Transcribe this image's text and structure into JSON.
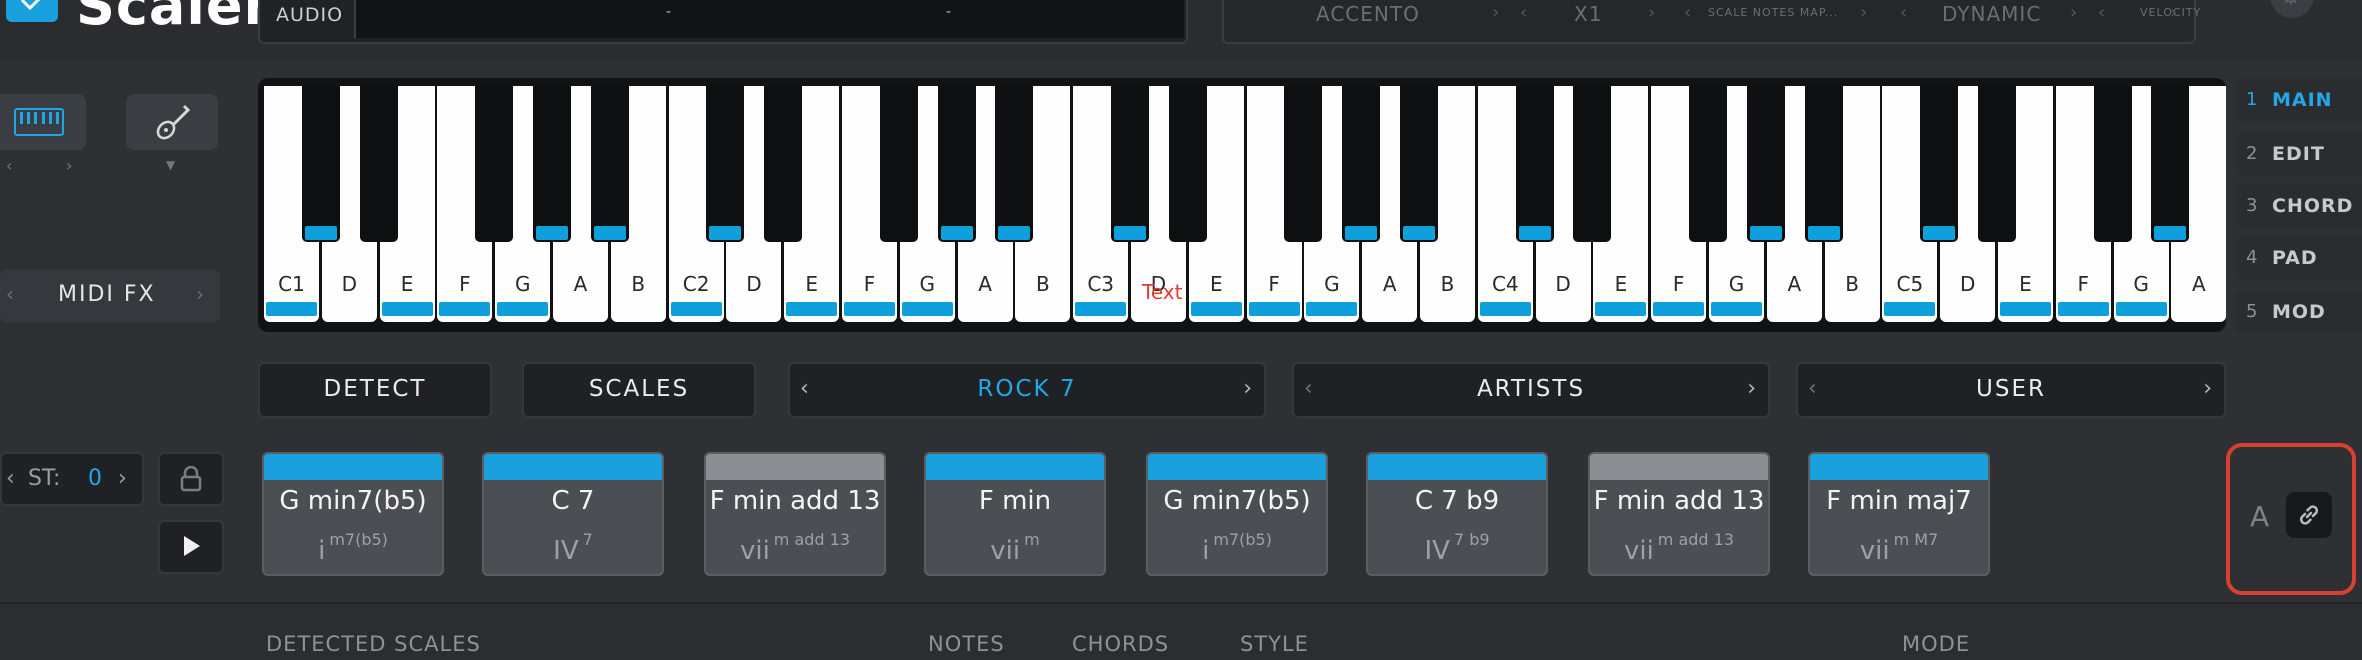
{
  "app": {
    "logo_text": "Scaler"
  },
  "top": {
    "audio_label": "AUDIO",
    "audio_dashes": [
      "-",
      "-"
    ],
    "params": [
      {
        "label": "ACCENTO"
      },
      {
        "label": "X1"
      },
      {
        "label": "SCALE NOTES MAP..."
      },
      {
        "label": "DYNAMIC"
      },
      {
        "label": "VELOCITY"
      }
    ]
  },
  "sidebar": {
    "midi_fx_label": "MIDI FX"
  },
  "keyboard": {
    "keys": [
      {
        "note": "C1",
        "blue": true
      },
      {
        "note": "D",
        "blue": false
      },
      {
        "note": "E",
        "blue": true
      },
      {
        "note": "F",
        "blue": true
      },
      {
        "note": "G",
        "blue": true
      },
      {
        "note": "A",
        "blue": false
      },
      {
        "note": "B",
        "blue": false
      },
      {
        "note": "C2",
        "blue": true
      },
      {
        "note": "D",
        "blue": false
      },
      {
        "note": "E",
        "blue": true
      },
      {
        "note": "F",
        "blue": true
      },
      {
        "note": "G",
        "blue": true
      },
      {
        "note": "A",
        "blue": false
      },
      {
        "note": "B",
        "blue": false
      },
      {
        "note": "C3",
        "blue": true
      },
      {
        "note": "D",
        "blue": false
      },
      {
        "note": "E",
        "blue": true
      },
      {
        "note": "F",
        "blue": true
      },
      {
        "note": "G",
        "blue": true
      },
      {
        "note": "A",
        "blue": false
      },
      {
        "note": "B",
        "blue": false
      },
      {
        "note": "C4",
        "blue": true
      },
      {
        "note": "D",
        "blue": false
      },
      {
        "note": "E",
        "blue": true
      },
      {
        "note": "F",
        "blue": true
      },
      {
        "note": "G",
        "blue": true
      },
      {
        "note": "A",
        "blue": false
      },
      {
        "note": "B",
        "blue": false
      },
      {
        "note": "C5",
        "blue": true
      },
      {
        "note": "D",
        "blue": false
      },
      {
        "note": "E",
        "blue": true
      },
      {
        "note": "F",
        "blue": true
      },
      {
        "note": "G",
        "blue": true
      },
      {
        "note": "A",
        "blue": false
      }
    ],
    "black_keys": [
      {
        "blue": true
      },
      {
        "blue": false
      },
      {
        "blue": false
      },
      {
        "blue": true
      },
      {
        "blue": true
      },
      {
        "blue": true
      },
      {
        "blue": false
      },
      {
        "blue": false
      },
      {
        "blue": true
      },
      {
        "blue": true
      },
      {
        "blue": true
      },
      {
        "blue": false
      },
      {
        "blue": false
      },
      {
        "blue": true
      },
      {
        "blue": true
      },
      {
        "blue": true
      },
      {
        "blue": false
      },
      {
        "blue": false
      },
      {
        "blue": true
      },
      {
        "blue": true
      },
      {
        "blue": true
      },
      {
        "blue": false
      },
      {
        "blue": false
      },
      {
        "blue": true
      },
      {
        "blue": true
      }
    ],
    "overlay_text": "Text"
  },
  "right_tabs": [
    {
      "num": "1",
      "label": "MAIN",
      "active": true
    },
    {
      "num": "2",
      "label": "EDIT",
      "active": false
    },
    {
      "num": "3",
      "label": "CHORD",
      "active": false
    },
    {
      "num": "4",
      "label": "PAD",
      "active": false
    },
    {
      "num": "5",
      "label": "MOD",
      "active": false
    }
  ],
  "controls": {
    "detect_label": "DETECT",
    "scales_label": "SCALES",
    "preset_value": "ROCK 7",
    "artists_label": "ARTISTS",
    "user_label": "USER",
    "accent_color": "#21a8e6"
  },
  "st": {
    "label": "ST:",
    "value": "0"
  },
  "chords": [
    {
      "name": "G min7(b5)",
      "degree": "i",
      "ext": "m7(b5)",
      "bar": "blue"
    },
    {
      "name": "C 7",
      "degree": "IV",
      "ext": "7",
      "bar": "blue"
    },
    {
      "name": "F min add 13",
      "degree": "vii",
      "ext": "m add 13",
      "bar": "gray"
    },
    {
      "name": "F min",
      "degree": "vii",
      "ext": "m",
      "bar": "blue"
    },
    {
      "name": "G min7(b5)",
      "degree": "i",
      "ext": "m7(b5)",
      "bar": "blue"
    },
    {
      "name": "C 7 b9",
      "degree": "IV",
      "ext": "7 b9",
      "bar": "blue"
    },
    {
      "name": "F min add 13",
      "degree": "vii",
      "ext": "m add 13",
      "bar": "gray"
    },
    {
      "name": "F min maj7",
      "degree": "vii",
      "ext": "m M7",
      "bar": "blue"
    }
  ],
  "a_label": "A",
  "bottom_headers": [
    "DETECTED SCALES",
    "NOTES",
    "CHORDS",
    "STYLE",
    "MODE"
  ],
  "colors": {
    "highlight": "#d7412f",
    "key_blue": "#0ea0dc"
  }
}
